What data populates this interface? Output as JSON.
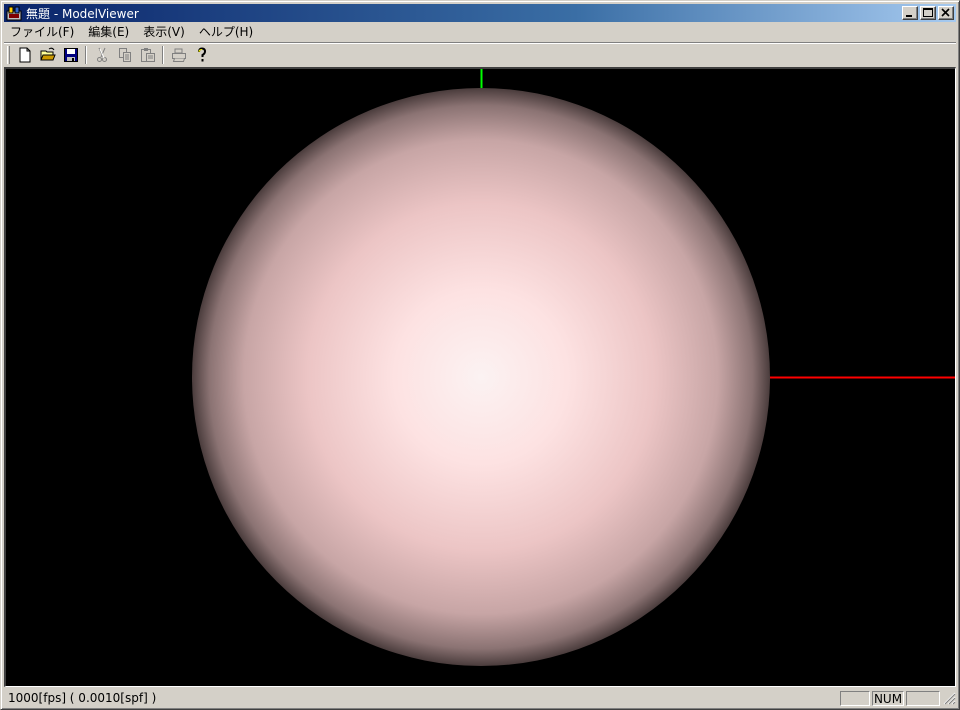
{
  "window": {
    "title": "無題 - ModelViewer",
    "controls": {
      "minimize_icon": "minimize-icon",
      "maximize_icon": "maximize-icon",
      "close_icon": "close-icon"
    }
  },
  "menu": {
    "items": [
      {
        "label": "ファイル(F)"
      },
      {
        "label": "編集(E)"
      },
      {
        "label": "表示(V)"
      },
      {
        "label": "ヘルプ(H)"
      }
    ]
  },
  "toolbar": {
    "buttons": [
      {
        "icon": "new-document-icon"
      },
      {
        "icon": "open-folder-icon"
      },
      {
        "icon": "save-disk-icon"
      },
      {
        "icon": "cut-scissors-icon",
        "disabled": true
      },
      {
        "icon": "copy-icon",
        "disabled": true
      },
      {
        "icon": "paste-icon",
        "disabled": true
      },
      {
        "icon": "print-icon",
        "disabled": true
      },
      {
        "icon": "help-question-icon"
      }
    ]
  },
  "viewport": {
    "background": "#000000",
    "model": "sphere",
    "sphere_color": "#f0caca",
    "axis_colors": {
      "x": "#ff0000",
      "y": "#00ff00"
    }
  },
  "status": {
    "message": "1000[fps] ( 0.0010[spf] )",
    "caps": "",
    "num": "NUM",
    "scrl": ""
  },
  "colors": {
    "titlebar_start": "#0a246a",
    "titlebar_end": "#a6caf0",
    "face": "#d4d0c8"
  }
}
